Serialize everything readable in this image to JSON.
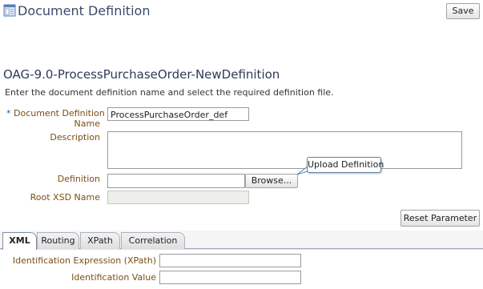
{
  "header": {
    "title": "Document Definition",
    "icon": "document-icon",
    "save_label": "Save"
  },
  "definition": {
    "name": "OAG-9.0-ProcessPurchaseOrder-NewDefinition",
    "instructions": "Enter the document definition name and select the required definition file."
  },
  "form": {
    "required_mark": "*",
    "doc_def_name_label_line1": "Document Definition",
    "doc_def_name_label_line2": "Name",
    "doc_def_name_value": "ProcessPurchaseOrder_def",
    "description_label": "Description",
    "description_value": "",
    "definition_label": "Definition",
    "definition_value": "",
    "browse_label": "Browse...",
    "root_xsd_label": "Root XSD Name",
    "root_xsd_value": ""
  },
  "tooltip": {
    "text": "Upload Definition"
  },
  "reset_label": "Reset Parameter",
  "tabs": [
    {
      "label": "XML",
      "active": true
    },
    {
      "label": "Routing",
      "active": false
    },
    {
      "label": "XPath",
      "active": false
    },
    {
      "label": "Correlation",
      "active": false
    }
  ],
  "xml_tab": {
    "id_expression_label": "Identification Expression (XPath)",
    "id_expression_value": "",
    "id_value_label": "Identification Value",
    "id_value_value": ""
  },
  "colors": {
    "label": "#7a4f13",
    "title": "#3a4a6a",
    "required": "#1a5fb4"
  }
}
